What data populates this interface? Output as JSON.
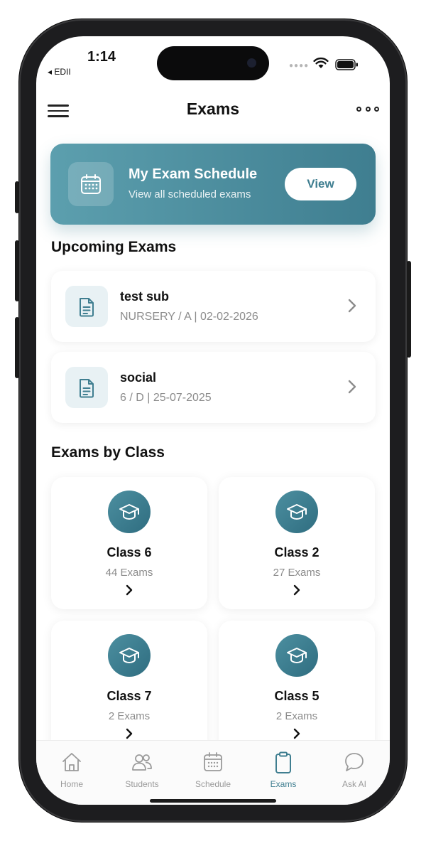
{
  "status_bar": {
    "time": "1:14",
    "back_label": "◂ EDII"
  },
  "header": {
    "title": "Exams"
  },
  "banner": {
    "title": "My Exam Schedule",
    "subtitle": "View all scheduled exams",
    "button_label": "View"
  },
  "upcoming": {
    "section_title": "Upcoming Exams",
    "items": [
      {
        "name": "test sub",
        "meta": "NURSERY / A | 02-02-2026"
      },
      {
        "name": "social",
        "meta": "6 / D | 25-07-2025"
      }
    ]
  },
  "by_class": {
    "section_title": "Exams by Class",
    "items": [
      {
        "name": "Class 6",
        "count": "44 Exams"
      },
      {
        "name": "Class 2",
        "count": "27 Exams"
      },
      {
        "name": "Class 7",
        "count": "2 Exams"
      },
      {
        "name": "Class 5",
        "count": "2 Exams"
      }
    ]
  },
  "tabbar": {
    "tabs": [
      {
        "label": "Home",
        "icon": "home-icon"
      },
      {
        "label": "Students",
        "icon": "students-icon"
      },
      {
        "label": "Schedule",
        "icon": "calendar-icon"
      },
      {
        "label": "Exams",
        "icon": "clipboard-icon",
        "active": true
      },
      {
        "label": "Ask AI",
        "icon": "chat-bubble-icon"
      }
    ]
  },
  "colors": {
    "accent": "#3f7e90",
    "banner_start": "#5c9fae",
    "text_muted": "#8c8c8c"
  }
}
